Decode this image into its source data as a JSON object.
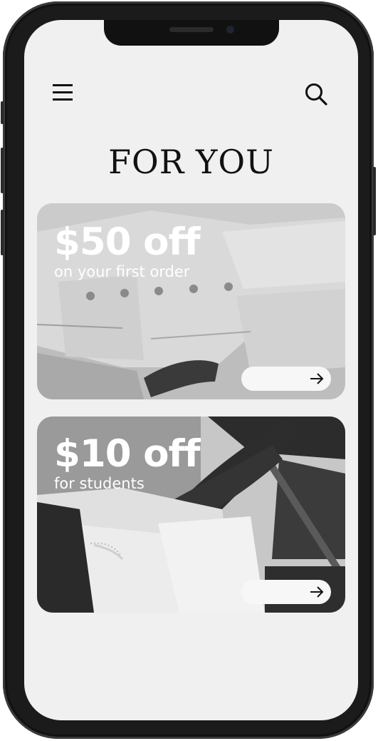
{
  "header": {
    "title": "FOR YOU",
    "menu_icon": "hamburger-menu-icon",
    "search_icon": "search-icon"
  },
  "promos": [
    {
      "amount": "$50 off",
      "subtitle": "on your first order",
      "action_icon": "arrow-right-icon"
    },
    {
      "amount": "$10 off",
      "subtitle": "for students",
      "action_icon": "arrow-right-icon"
    }
  ],
  "colors": {
    "screen_background": "#f0f0f0",
    "text_dark": "#111111",
    "promo_text": "#ffffff",
    "button_background": "#f7f7f7"
  }
}
